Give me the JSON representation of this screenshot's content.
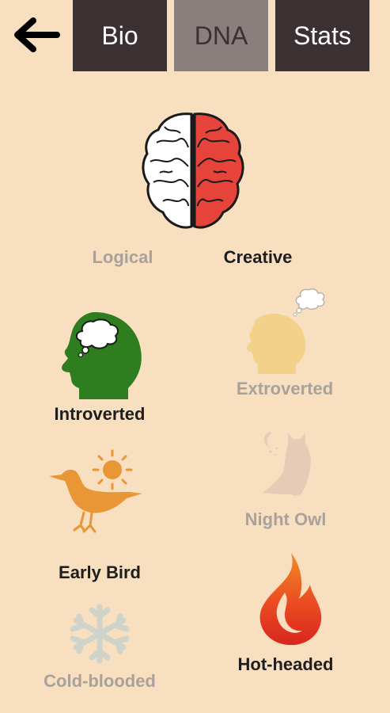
{
  "header": {
    "back_icon": "left-arrow-icon",
    "tabs": [
      {
        "id": "bio",
        "label": "Bio",
        "active": false
      },
      {
        "id": "dna",
        "label": "DNA",
        "active": true
      },
      {
        "id": "stats",
        "label": "Stats",
        "active": false
      }
    ]
  },
  "traits": {
    "logical": {
      "label": "Logical",
      "active": false
    },
    "creative": {
      "label": "Creative",
      "active": true
    },
    "introverted": {
      "label": "Introverted",
      "active": true
    },
    "extroverted": {
      "label": "Extroverted",
      "active": false
    },
    "early_bird": {
      "label": "Early Bird",
      "active": true
    },
    "night_owl": {
      "label": "Night Owl",
      "active": false
    },
    "cold_blooded": {
      "label": "Cold-blooded",
      "active": false
    },
    "hot_headed": {
      "label": "Hot-headed",
      "active": true
    }
  },
  "icons": {
    "brain": "brain-icon",
    "introvert_head": "head-thought-icon",
    "extrovert_head": "head-thought-faded-icon",
    "bird": "bird-sun-icon",
    "owl": "owl-moon-icon",
    "snowflake": "snowflake-icon",
    "flame": "flame-icon"
  },
  "colors": {
    "background": "#f7dfc0",
    "tab_dark": "#3b3132",
    "tab_active": "#8a7f7d",
    "introvert_green": "#2e7d1e",
    "extrovert_faded": "#f2d188",
    "bird_orange": "#e89636",
    "owl_faded": "#e6cbb7",
    "snow_faded": "#cfd3c9",
    "flame_red": "#e0301e",
    "brain_red": "#e6443a"
  }
}
